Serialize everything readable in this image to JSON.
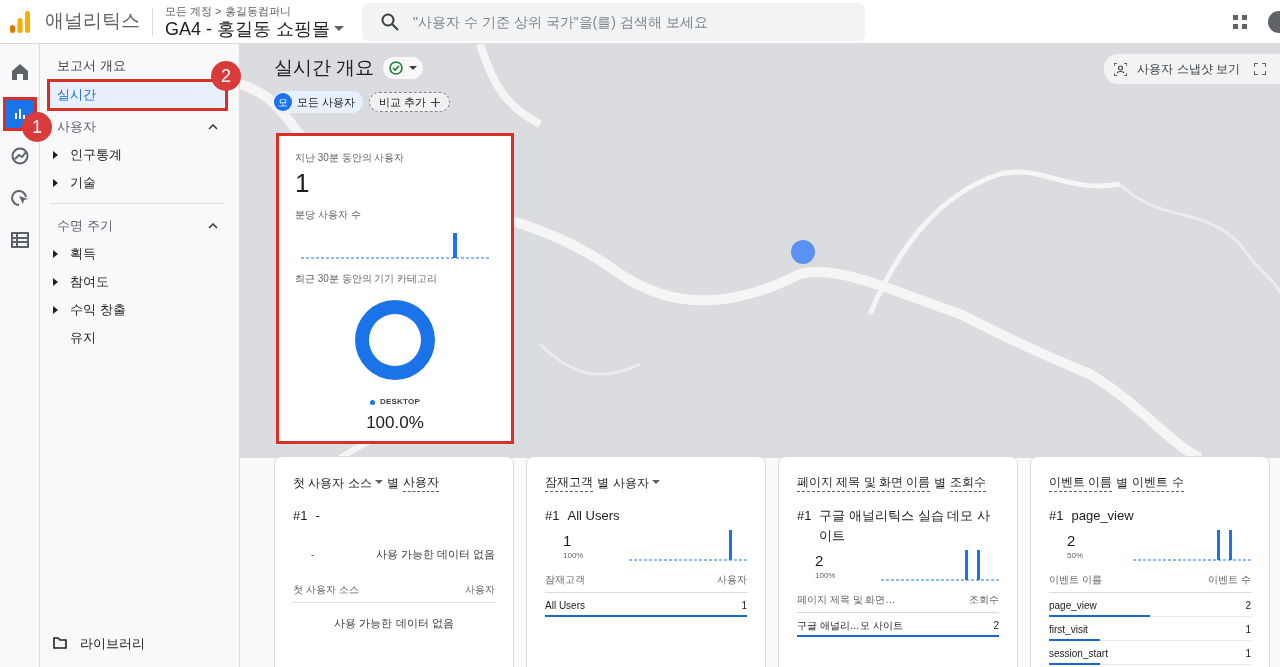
{
  "header": {
    "app_name": "애널리틱스",
    "breadcrumb": "모든 계정 > 홍길동컴퍼니",
    "property": "GA4 - 홍길동 쇼핑몰",
    "search": {
      "placeholder": "\"사용자 수 기준 상위 국가\"을(를) 검색해 보세요"
    }
  },
  "rail": [
    {
      "kind": "home",
      "selected": false,
      "highlighted": false
    },
    {
      "kind": "reports",
      "selected": true,
      "highlighted": true
    },
    {
      "kind": "explore",
      "selected": false,
      "highlighted": false
    },
    {
      "kind": "advertising",
      "selected": false,
      "highlighted": false
    },
    {
      "kind": "configure",
      "selected": false,
      "highlighted": false
    }
  ],
  "nav": {
    "top_items": [
      {
        "label": "보고서 개요",
        "selected": false,
        "highlighted": false
      },
      {
        "label": "실시간",
        "selected": true,
        "highlighted": true
      }
    ],
    "sections": [
      {
        "label": "사용자",
        "expanded": true,
        "items": [
          {
            "label": "인구통계",
            "expandable": true
          },
          {
            "label": "기술",
            "expandable": true
          }
        ]
      },
      {
        "label": "수명 주기",
        "expanded": true,
        "items": [
          {
            "label": "획득",
            "expandable": true
          },
          {
            "label": "참여도",
            "expandable": true
          },
          {
            "label": "수익 창출",
            "expandable": true
          },
          {
            "label": "유지",
            "expandable": false
          }
        ]
      }
    ],
    "library": "라이브러리"
  },
  "page": {
    "title": "실시간 개요",
    "segments": [
      {
        "avatar": "모",
        "label": "모든 사용자"
      }
    ],
    "add_comparison": "비교 추가",
    "snapshot_button": "사용자 스냅샷 보기"
  },
  "summary_card": {
    "highlighted": true,
    "users_label": "지난 30분 동안의 사용자",
    "users_value": "1",
    "per_minute_label": "분당 사용자 수",
    "device_label": "최근 30분 동안의 기기 카테고리",
    "device_category": "DESKTOP",
    "device_share": "100.0%"
  },
  "cards": [
    {
      "kind": "empty",
      "title": [
        {
          "text": "첫 사용자 소스",
          "kind": "dropdown"
        },
        {
          "text": "별",
          "kind": "plain"
        },
        {
          "text": "사용자",
          "kind": "underlined"
        }
      ],
      "rank": "#1",
      "top_name": "-",
      "value": "-",
      "message": "사용 가능한 데이터 없음",
      "columns": [
        "첫 사용자 소스",
        "사용자"
      ],
      "empty_text": "사용 가능한 데이터 없음"
    },
    {
      "kind": "data",
      "title": [
        {
          "text": "잠재고객",
          "kind": "underlined"
        },
        {
          "text": "별",
          "kind": "plain"
        },
        {
          "text": "사용자",
          "kind": "dropdown"
        }
      ],
      "rank": "#1",
      "top_name": "All Users",
      "value": "1",
      "percent": "100%",
      "columns": [
        "잠재고객",
        "사용자"
      ],
      "rows": [
        {
          "name": "All Users",
          "value": "1",
          "level": 1.0
        }
      ]
    },
    {
      "kind": "data",
      "title": [
        {
          "text": "페이지 제목 및 화면 이름",
          "kind": "underlined"
        },
        {
          "text": "별",
          "kind": "plain"
        },
        {
          "text": "조회수",
          "kind": "underlined"
        }
      ],
      "rank": "#1",
      "top_name": "구글 애널리틱스 실습 데모 사이트",
      "value": "2",
      "percent": "100%",
      "columns": [
        "페이지 제목 및 화면…",
        "조회수"
      ],
      "rows": [
        {
          "name": "구글 애널리…모 사이트",
          "value": "2",
          "level": 1.0
        }
      ]
    },
    {
      "kind": "data",
      "title": [
        {
          "text": "이벤트 이름",
          "kind": "underlined"
        },
        {
          "text": "별",
          "kind": "plain"
        },
        {
          "text": "이벤트 수",
          "kind": "underlined"
        }
      ],
      "rank": "#1",
      "top_name": "page_view",
      "value": "2",
      "percent": "50%",
      "columns": [
        "이벤트 이름",
        "이벤트 수"
      ],
      "rows": [
        {
          "name": "page_view",
          "value": "2",
          "level": 0.5
        },
        {
          "name": "first_visit",
          "value": "1",
          "level": 0.25
        },
        {
          "name": "session_start",
          "value": "1",
          "level": 0.25
        }
      ]
    }
  ],
  "annotations": [
    {
      "label": "1"
    },
    {
      "label": "2"
    }
  ]
}
